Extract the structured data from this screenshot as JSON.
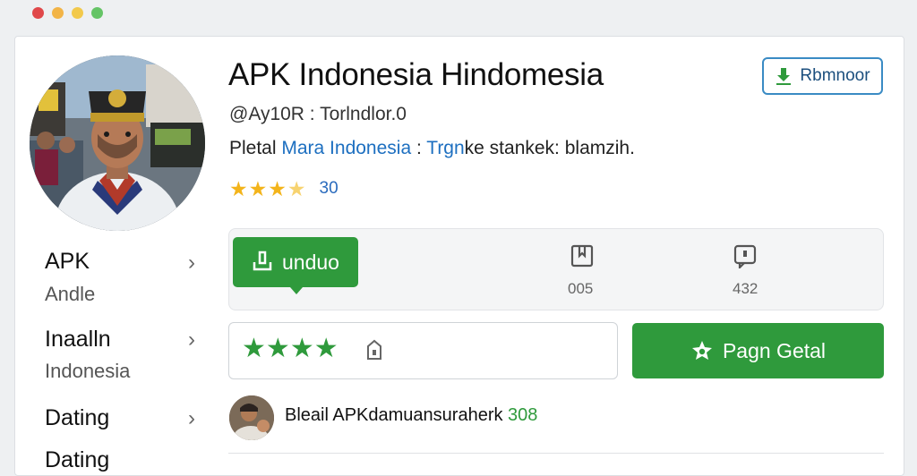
{
  "window": {
    "controls": [
      "close",
      "minimize",
      "zoom",
      "extra"
    ]
  },
  "app": {
    "title": "APK Indonesia Hindomesia",
    "handle": "@Ay10R : Torlndlor.0",
    "description_prefix": "Pletal ",
    "description_highlight_1": "Mara Indonesia",
    "description_separator": " : ",
    "description_highlight_2": "Trgn",
    "description_suffix": "ke stankek: blamzih.",
    "rating_stars": 3.5,
    "rating_count": "30"
  },
  "reminder_button": {
    "label": "Rbmnoor",
    "icon": "download-icon"
  },
  "sidebar": {
    "items": [
      {
        "label": "APK",
        "sub": "Andle"
      },
      {
        "label": "Inaalln",
        "sub": "Indonesia"
      },
      {
        "label": "Dating",
        "sub": ""
      },
      {
        "label": "Dating",
        "sub": ""
      }
    ]
  },
  "actions": {
    "download_label": "unduo",
    "stat_1": {
      "icon": "bookmark-icon",
      "value": "005"
    },
    "stat_2": {
      "icon": "chat-icon",
      "value": "432"
    }
  },
  "rating_input": {
    "stars": 4,
    "icon": "tag-icon"
  },
  "primary_button": {
    "label": "Pagn Getal",
    "icon": "star-badge-icon"
  },
  "review": {
    "text": "Bleail APKdamuansuraherk ",
    "count": "308"
  },
  "colors": {
    "accent_green": "#2f9a3c",
    "accent_blue": "#3a8bc4",
    "star_yellow": "#f3b41b"
  }
}
